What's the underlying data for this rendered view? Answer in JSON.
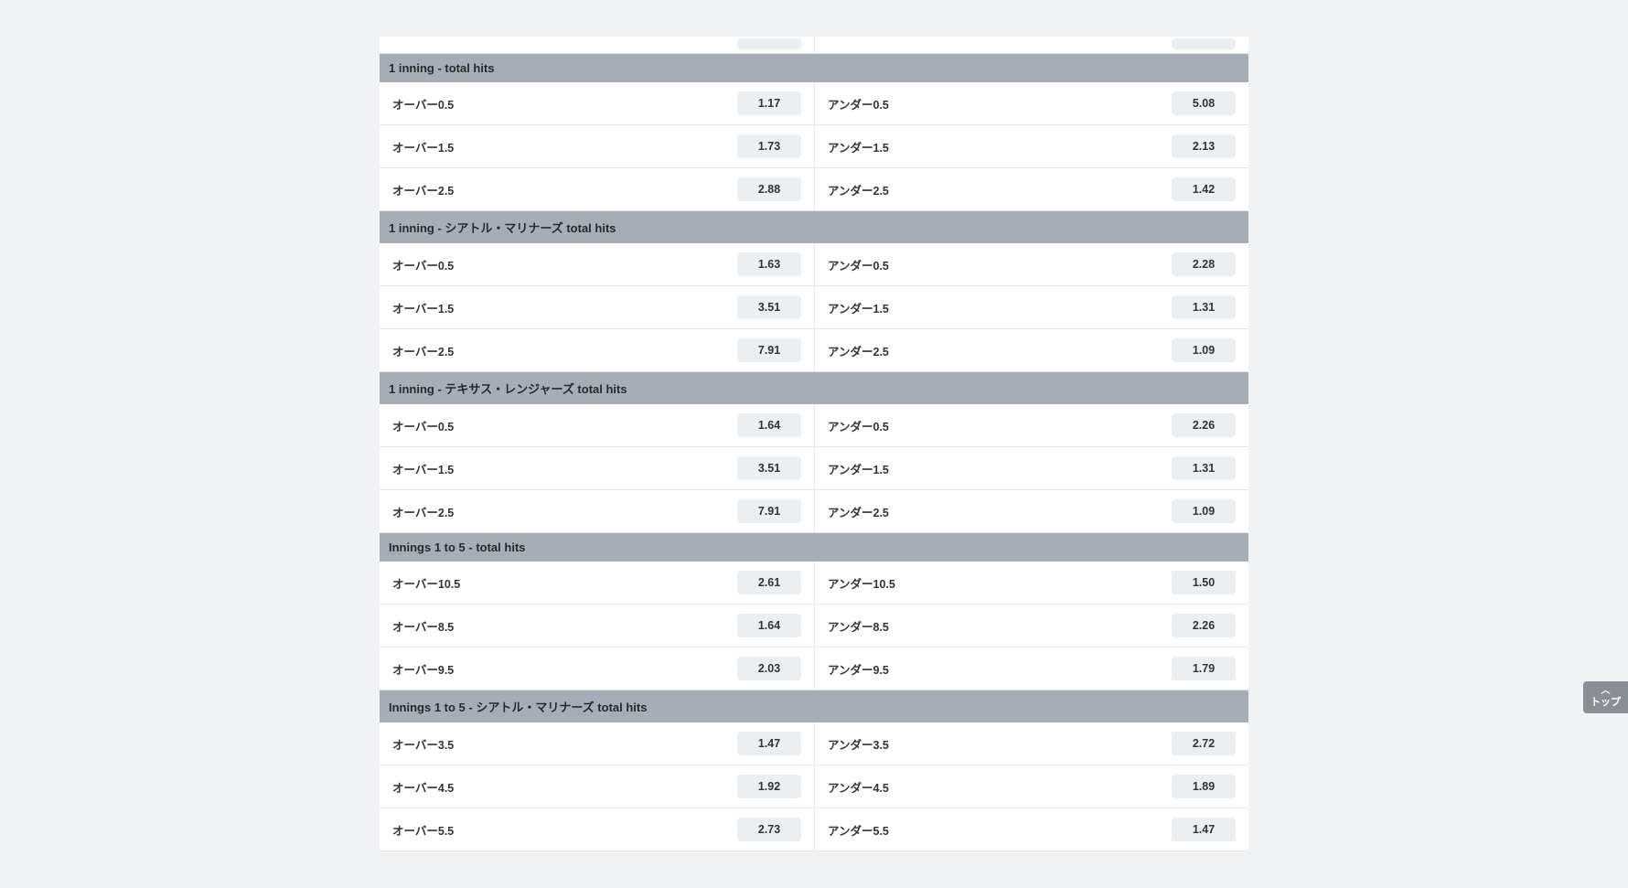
{
  "scroll_top_label": "トップ",
  "markets": [
    {
      "title": "1 inning - total hits",
      "rows": [
        {
          "over_label": "オーバー0.5",
          "over_odds": "1.17",
          "under_label": "アンダー0.5",
          "under_odds": "5.08"
        },
        {
          "over_label": "オーバー1.5",
          "over_odds": "1.73",
          "under_label": "アンダー1.5",
          "under_odds": "2.13"
        },
        {
          "over_label": "オーバー2.5",
          "over_odds": "2.88",
          "under_label": "アンダー2.5",
          "under_odds": "1.42"
        }
      ]
    },
    {
      "title": "1 inning - シアトル・マリナーズ total hits",
      "rows": [
        {
          "over_label": "オーバー0.5",
          "over_odds": "1.63",
          "under_label": "アンダー0.5",
          "under_odds": "2.28"
        },
        {
          "over_label": "オーバー1.5",
          "over_odds": "3.51",
          "under_label": "アンダー1.5",
          "under_odds": "1.31"
        },
        {
          "over_label": "オーバー2.5",
          "over_odds": "7.91",
          "under_label": "アンダー2.5",
          "under_odds": "1.09"
        }
      ]
    },
    {
      "title": "1 inning - テキサス・レンジャーズ total hits",
      "rows": [
        {
          "over_label": "オーバー0.5",
          "over_odds": "1.64",
          "under_label": "アンダー0.5",
          "under_odds": "2.26"
        },
        {
          "over_label": "オーバー1.5",
          "over_odds": "3.51",
          "under_label": "アンダー1.5",
          "under_odds": "1.31"
        },
        {
          "over_label": "オーバー2.5",
          "over_odds": "7.91",
          "under_label": "アンダー2.5",
          "under_odds": "1.09"
        }
      ]
    },
    {
      "title": "Innings 1 to 5 - total hits",
      "rows": [
        {
          "over_label": "オーバー10.5",
          "over_odds": "2.61",
          "under_label": "アンダー10.5",
          "under_odds": "1.50"
        },
        {
          "over_label": "オーバー8.5",
          "over_odds": "1.64",
          "under_label": "アンダー8.5",
          "under_odds": "2.26"
        },
        {
          "over_label": "オーバー9.5",
          "over_odds": "2.03",
          "under_label": "アンダー9.5",
          "under_odds": "1.79"
        }
      ]
    },
    {
      "title": "Innings 1 to 5 - シアトル・マリナーズ total hits",
      "rows": [
        {
          "over_label": "オーバー3.5",
          "over_odds": "1.47",
          "under_label": "アンダー3.5",
          "under_odds": "2.72"
        },
        {
          "over_label": "オーバー4.5",
          "over_odds": "1.92",
          "under_label": "アンダー4.5",
          "under_odds": "1.89"
        },
        {
          "over_label": "オーバー5.5",
          "over_odds": "2.73",
          "under_label": "アンダー5.5",
          "under_odds": "1.47"
        }
      ]
    }
  ]
}
